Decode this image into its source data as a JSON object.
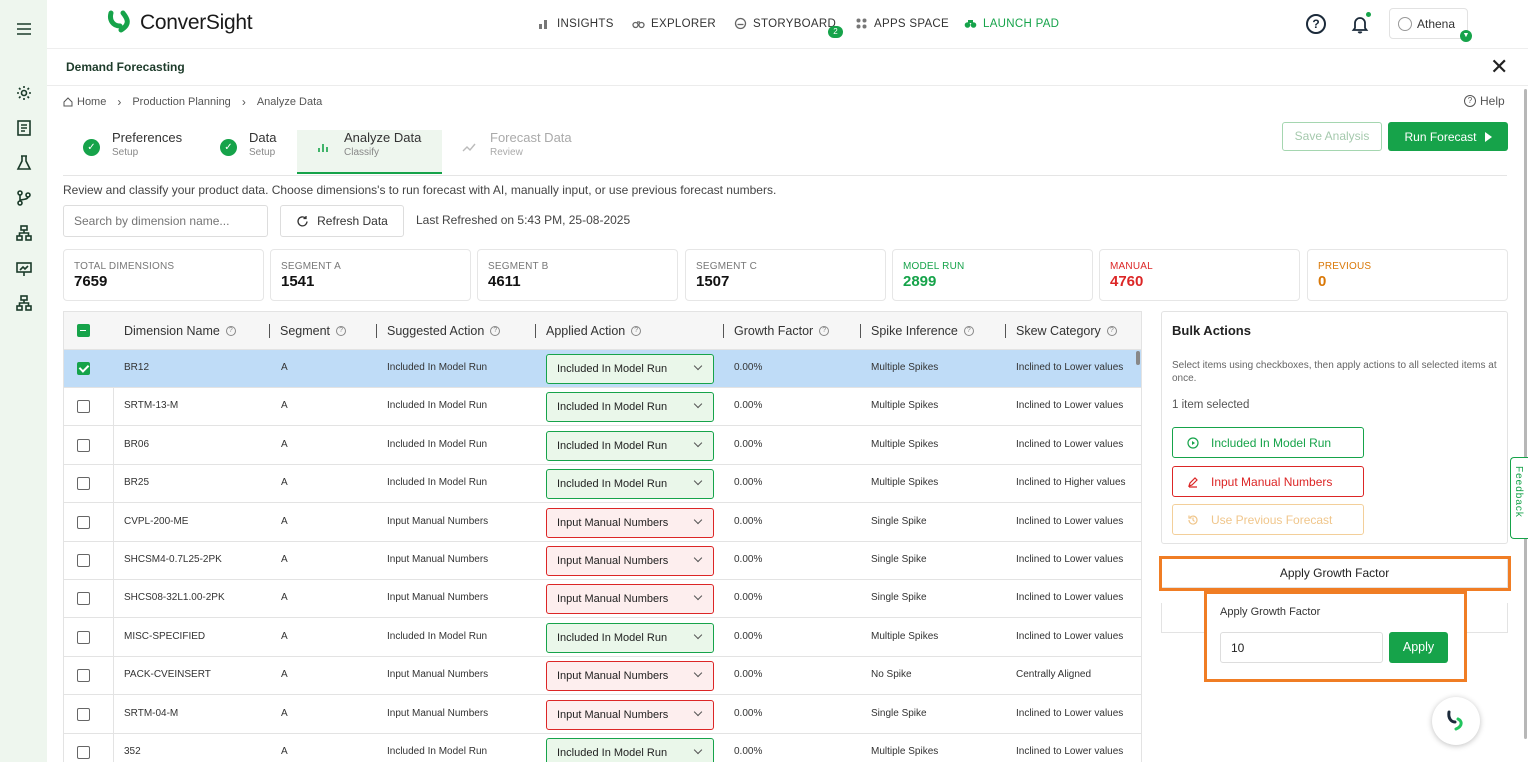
{
  "app": {
    "name": "ConverSight",
    "colors": {
      "accent": "#16a34a",
      "danger": "#dc2626",
      "warning": "#d97706",
      "highlight": "#f07d24"
    }
  },
  "nav": {
    "insights": "INSIGHTS",
    "explorer": "EXPLORER",
    "storyboard": "STORYBOARD",
    "storyboard_badge": "2",
    "apps_space": "APPS SPACE",
    "launch_pad": "LAUNCH PAD"
  },
  "user": {
    "name": "Athena"
  },
  "panel": {
    "title": "Demand Forecasting"
  },
  "breadcrumb": {
    "home": "Home",
    "section": "Production Planning",
    "current": "Analyze Data"
  },
  "help": "Help",
  "steps": [
    {
      "title": "Preferences",
      "sub": "Setup"
    },
    {
      "title": "Data",
      "sub": "Setup"
    },
    {
      "title": "Analyze Data",
      "sub": "Classify"
    },
    {
      "title": "Forecast Data",
      "sub": "Review"
    }
  ],
  "buttons": {
    "save_analysis": "Save Analysis",
    "run_forecast": "Run Forecast",
    "refresh": "Refresh Data"
  },
  "description": "Review and classify your product data. Choose dimensions's to run forecast with AI, manually input, or use previous forecast numbers.",
  "search": {
    "placeholder": "Search by dimension name..."
  },
  "last_refreshed": "Last Refreshed on 5:43 PM, 25-08-2025",
  "stats": [
    {
      "label": "TOTAL DIMENSIONS",
      "value": "7659"
    },
    {
      "label": "SEGMENT A",
      "value": "1541"
    },
    {
      "label": "SEGMENT B",
      "value": "4611"
    },
    {
      "label": "SEGMENT C",
      "value": "1507"
    },
    {
      "label": "MODEL RUN",
      "value": "2899"
    },
    {
      "label": "MANUAL",
      "value": "4760"
    },
    {
      "label": "PREVIOUS",
      "value": "0"
    }
  ],
  "table": {
    "headers": {
      "dimension": "Dimension Name",
      "segment": "Segment",
      "suggested": "Suggested Action",
      "applied": "Applied Action",
      "growth": "Growth Factor",
      "spike": "Spike Inference",
      "skew": "Skew Category"
    },
    "rows": [
      {
        "name": "BR12",
        "segment": "A",
        "suggested": "Included In Model Run",
        "applied": "Included In Model Run",
        "growth": "0.00%",
        "spike": "Multiple Spikes",
        "skew": "Inclined to Lower values"
      },
      {
        "name": "SRTM-13-M",
        "segment": "A",
        "suggested": "Included In Model Run",
        "applied": "Included In Model Run",
        "growth": "0.00%",
        "spike": "Multiple Spikes",
        "skew": "Inclined to Lower values"
      },
      {
        "name": "BR06",
        "segment": "A",
        "suggested": "Included In Model Run",
        "applied": "Included In Model Run",
        "growth": "0.00%",
        "spike": "Multiple Spikes",
        "skew": "Inclined to Lower values"
      },
      {
        "name": "BR25",
        "segment": "A",
        "suggested": "Included In Model Run",
        "applied": "Included In Model Run",
        "growth": "0.00%",
        "spike": "Multiple Spikes",
        "skew": "Inclined to Higher values"
      },
      {
        "name": "CVPL-200-ME",
        "segment": "A",
        "suggested": "Input Manual Numbers",
        "applied": "Input Manual Numbers",
        "growth": "0.00%",
        "spike": "Single Spike",
        "skew": "Inclined to Lower values"
      },
      {
        "name": "SHCSM4-0.7L25-2PK",
        "segment": "A",
        "suggested": "Input Manual Numbers",
        "applied": "Input Manual Numbers",
        "growth": "0.00%",
        "spike": "Single Spike",
        "skew": "Inclined to Lower values"
      },
      {
        "name": "SHCS08-32L1.00-2PK",
        "segment": "A",
        "suggested": "Input Manual Numbers",
        "applied": "Input Manual Numbers",
        "growth": "0.00%",
        "spike": "Single Spike",
        "skew": "Inclined to Lower values"
      },
      {
        "name": "MISC-SPECIFIED",
        "segment": "A",
        "suggested": "Included In Model Run",
        "applied": "Included In Model Run",
        "growth": "0.00%",
        "spike": "Multiple Spikes",
        "skew": "Inclined to Lower values"
      },
      {
        "name": "PACK-CVEINSERT",
        "segment": "A",
        "suggested": "Input Manual Numbers",
        "applied": "Input Manual Numbers",
        "growth": "0.00%",
        "spike": "No Spike",
        "skew": "Centrally Aligned"
      },
      {
        "name": "SRTM-04-M",
        "segment": "A",
        "suggested": "Input Manual Numbers",
        "applied": "Input Manual Numbers",
        "growth": "0.00%",
        "spike": "Single Spike",
        "skew": "Inclined to Lower values"
      },
      {
        "name": "352",
        "segment": "A",
        "suggested": "Included In Model Run",
        "applied": "Included In Model Run",
        "growth": "0.00%",
        "spike": "Multiple Spikes",
        "skew": "Inclined to Lower values"
      }
    ]
  },
  "bulk": {
    "title": "Bulk Actions",
    "description": "Select items using checkboxes, then apply actions to all selected items at once.",
    "selected": "1 item selected",
    "include": "Included In Model Run",
    "manual": "Input Manual Numbers",
    "previous": "Use Previous Forecast"
  },
  "growth": {
    "header": "Apply Growth Factor",
    "label": "Apply Growth Factor",
    "value": "10",
    "apply": "Apply"
  },
  "feedback": "Feedback"
}
